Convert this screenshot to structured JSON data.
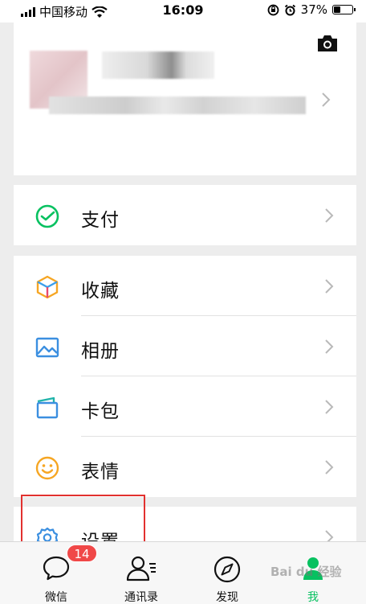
{
  "status_bar": {
    "carrier": "中国移动",
    "time": "16:09",
    "battery_percent": "37%",
    "battery_level": 0.37
  },
  "menu": {
    "pay": "支付",
    "favorites": "收藏",
    "album": "相册",
    "cards": "卡包",
    "stickers": "表情",
    "settings": "设置"
  },
  "tabbar": {
    "chats": "微信",
    "contacts": "通讯录",
    "discover": "发现",
    "me": "我",
    "chats_badge": "14",
    "active_color": "#07c160"
  },
  "watermark": "Bai du 经验",
  "colors": {
    "highlight": "#e2312f",
    "badge": "#f04848"
  }
}
